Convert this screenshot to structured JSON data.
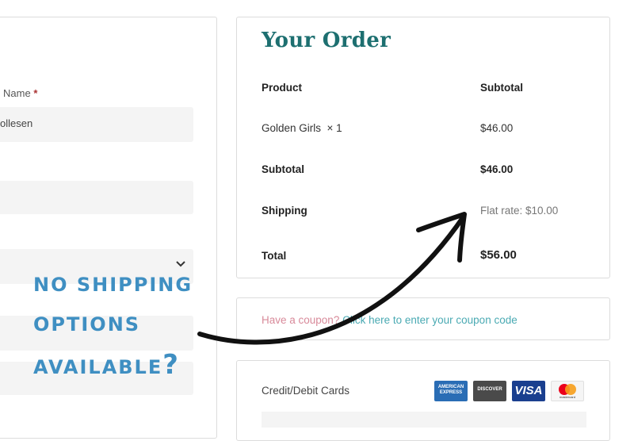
{
  "billing": {
    "name_label": "Name",
    "required_mark": "*",
    "name_value": "ollesen"
  },
  "order": {
    "title": "Your Order",
    "product_header": "Product",
    "subtotal_header": "Subtotal",
    "item_name": "Golden Girls",
    "item_qty": "× 1",
    "item_price": "$46.00",
    "subtotal_label": "Subtotal",
    "subtotal_value": "$46.00",
    "shipping_label": "Shipping",
    "shipping_value": "Flat rate: $10.00",
    "total_label": "Total",
    "total_value": "$56.00"
  },
  "coupon": {
    "prompt": "Have a coupon?",
    "link": "Click here to enter your coupon code"
  },
  "payment": {
    "method_label": "Credit/Debit Cards",
    "cards": [
      "AMERICAN EXPRESS",
      "DISCOVER",
      "VISA",
      "mastercard"
    ]
  },
  "annotation": {
    "line1": "NO SHIPPING",
    "line2": "OPTIONS",
    "line3": "AVAILABLE",
    "mark": "?"
  },
  "colors": {
    "title": "#1d6f70",
    "annotation": "#3f8fc2",
    "coupon_prompt": "#d88a9a",
    "coupon_link": "#4aaab3"
  }
}
